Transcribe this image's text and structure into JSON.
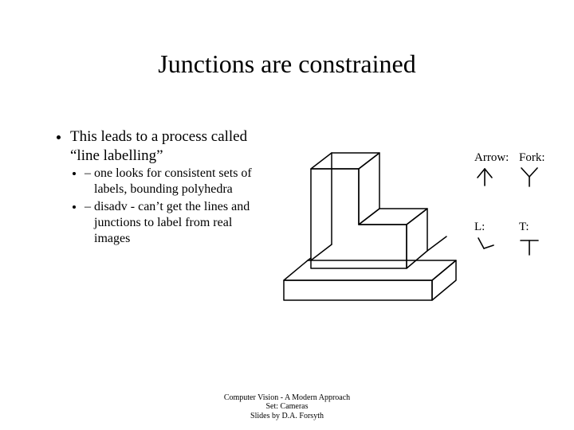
{
  "title": "Junctions are constrained",
  "bullets": {
    "main": "This leads to a process called “line labelling”",
    "subs": [
      "one looks for consistent sets of labels, bounding polyhedra",
      "disadv - can’t get the lines and junctions to label from real images"
    ]
  },
  "junctions": {
    "arrow_label": "Arrow:",
    "fork_label": "Fork:",
    "l_label": "L:",
    "t_label": "T:"
  },
  "footer": {
    "line1": "Computer Vision - A Modern Approach",
    "line2": "Set:  Cameras",
    "line3": "Slides by D.A. Forsyth"
  }
}
